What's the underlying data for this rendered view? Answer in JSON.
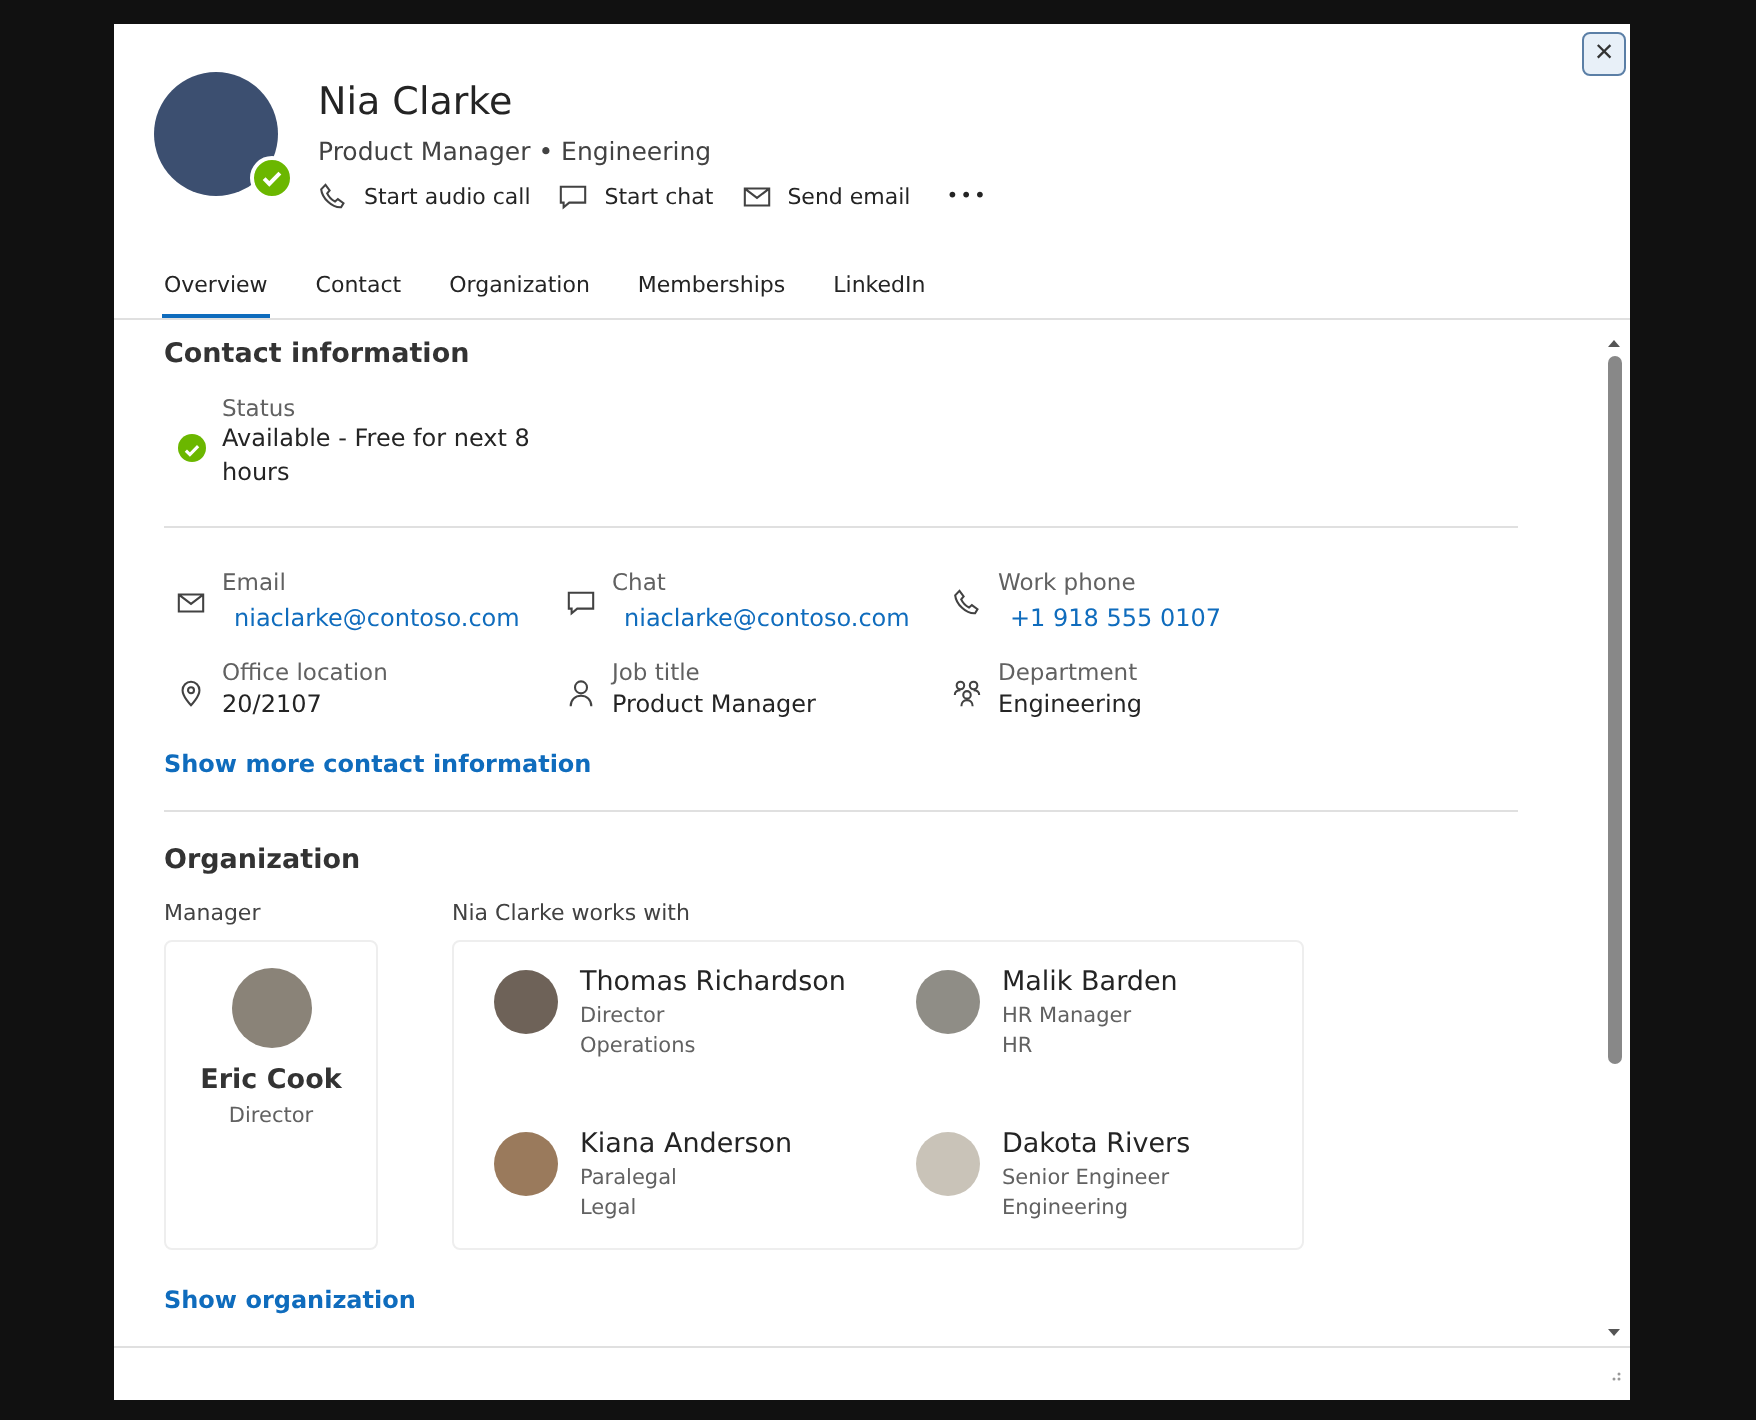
{
  "profile": {
    "name": "Nia Clarke",
    "subtitle": "Product Manager • Engineering",
    "available": true
  },
  "actions": [
    {
      "label": "Start audio call"
    },
    {
      "label": "Start chat"
    },
    {
      "label": "Send email"
    }
  ],
  "more_button": "•••",
  "close_button": "×",
  "tabs": [
    {
      "label": "Overview",
      "selected": true
    },
    {
      "label": "Contact",
      "selected": false
    },
    {
      "label": "Organization",
      "selected": false
    },
    {
      "label": "Memberships",
      "selected": false
    },
    {
      "label": "LinkedIn",
      "selected": false
    }
  ],
  "contact_information": {
    "title": "Contact information",
    "status": {
      "label": "Status",
      "value": "Available - Free for next 8 hours",
      "available": true
    },
    "fields": [
      {
        "label": "Email",
        "value": "niaclarke@contoso.com",
        "kind": "link"
      },
      {
        "label": "Chat",
        "value": "niaclarke@contoso.com",
        "kind": "link"
      },
      {
        "label": "Work phone",
        "value": "+1 918 555 0107",
        "kind": "link"
      },
      {
        "label": "Office location",
        "value": "20/2107",
        "kind": "text"
      },
      {
        "label": "Job title",
        "value": "Product Manager",
        "kind": "text"
      },
      {
        "label": "Department",
        "value": "Engineering",
        "kind": "text"
      }
    ],
    "more_link": "Show more contact information"
  },
  "organization": {
    "title": "Organization",
    "manager_label": "Manager",
    "manager": {
      "name": "Eric Cook",
      "title": "Director"
    },
    "works_with_label": "Nia Clarke works with",
    "coworkers": [
      {
        "name": "Thomas Richardson",
        "title": "Director",
        "department": "Operations"
      },
      {
        "name": "Malik Barden",
        "title": "HR Manager",
        "department": "HR"
      },
      {
        "name": "Kiana Anderson",
        "title": "Paralegal",
        "department": "Legal"
      },
      {
        "name": "Dakota Rivers",
        "title": "Senior Engineer",
        "department": "Engineering"
      }
    ],
    "more_link": "Show organization"
  }
}
